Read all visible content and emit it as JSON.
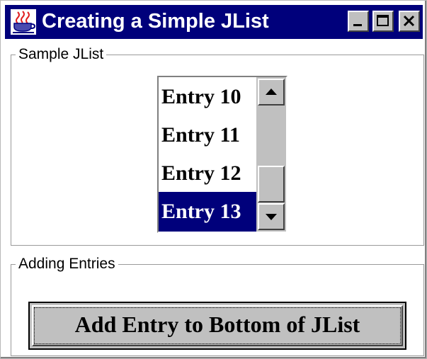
{
  "window": {
    "title": "Creating a Simple JList",
    "app_icon": "java-cup-icon",
    "controls": [
      {
        "name": "minimize",
        "icon": "minimize-icon"
      },
      {
        "name": "maximize",
        "icon": "maximize-icon"
      },
      {
        "name": "close",
        "icon": "close-icon"
      }
    ]
  },
  "sample_panel": {
    "legend": "Sample JList",
    "list_items": [
      {
        "label": "Entry 10",
        "selected": false
      },
      {
        "label": "Entry 11",
        "selected": false
      },
      {
        "label": "Entry 12",
        "selected": false
      },
      {
        "label": "Entry 13",
        "selected": true
      }
    ],
    "scrollbar": {
      "up_icon": "arrow-up-icon",
      "down_icon": "arrow-down-icon"
    }
  },
  "adding_panel": {
    "legend": "Adding Entries",
    "button_label": "Add Entry to Bottom of JList"
  },
  "colors": {
    "title_bar": "#00007b",
    "selection": "#00007b",
    "control_face": "#c0c0c0",
    "background": "#ffffff"
  }
}
